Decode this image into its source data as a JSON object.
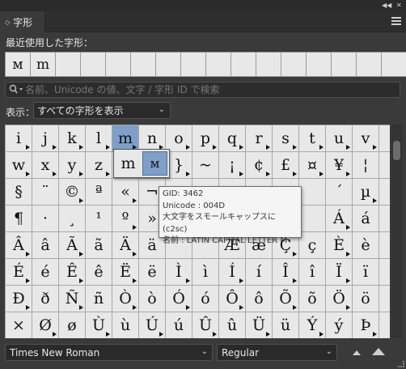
{
  "tab": {
    "title": "字形"
  },
  "recent": {
    "label": "最近使用した字形：",
    "glyphs": [
      "ᴍ",
      "m",
      "",
      "",
      "",
      "",
      "",
      "",
      "",
      "",
      "",
      "",
      "",
      "",
      "",
      ""
    ]
  },
  "search": {
    "placeholder": "名前、Unicode の値、文字 / 字形 ID で検索",
    "value": ""
  },
  "show": {
    "label": "表示：",
    "selected": "すべての字形を表示"
  },
  "glyph_grid": {
    "rows": [
      [
        "i",
        "j",
        "k",
        "l",
        "m",
        "n",
        "o",
        "p",
        "q",
        "r",
        "s",
        "t",
        "u",
        "v",
        ""
      ],
      [
        "w",
        "x",
        "y",
        "z",
        "",
        "",
        "}",
        "~",
        "¡",
        "¢",
        "£",
        "¤",
        "¥",
        "¦",
        ""
      ],
      [
        "§",
        "¨",
        "©",
        "ª",
        "«",
        "¬",
        "",
        "",
        "",
        "",
        "",
        "",
        "´",
        "µ",
        ""
      ],
      [
        "¶",
        "·",
        "¸",
        "¹",
        "º",
        "»",
        "",
        "",
        "",
        "",
        "",
        "",
        "Á",
        "á",
        ""
      ],
      [
        "Â",
        "â",
        "Ã",
        "ã",
        "Ä",
        "ä",
        "",
        "",
        "Æ",
        "æ",
        "Ç",
        "ç",
        "È",
        "è",
        ""
      ],
      [
        "É",
        "é",
        "Ê",
        "ê",
        "Ë",
        "ë",
        "Ì",
        "ì",
        "Í",
        "í",
        "Î",
        "î",
        "Ï",
        "ï",
        ""
      ],
      [
        "Ð",
        "ð",
        "Ñ",
        "ñ",
        "Ò",
        "ò",
        "Ó",
        "ó",
        "Ô",
        "ô",
        "Õ",
        "õ",
        "Ö",
        "ö",
        ""
      ],
      [
        "×",
        "Ø",
        "ø",
        "Ù",
        "ù",
        "Ú",
        "ú",
        "Û",
        "û",
        "Ü",
        "ü",
        "Ý",
        "ý",
        "Þ",
        ""
      ]
    ],
    "alternates_marked": [
      [
        0,
        0
      ],
      [
        0,
        1
      ],
      [
        0,
        2
      ],
      [
        0,
        3
      ],
      [
        0,
        4
      ],
      [
        0,
        5
      ],
      [
        0,
        6
      ],
      [
        0,
        7
      ],
      [
        0,
        8
      ],
      [
        0,
        9
      ],
      [
        0,
        10
      ],
      [
        0,
        11
      ],
      [
        0,
        12
      ],
      [
        0,
        13
      ],
      [
        1,
        0
      ],
      [
        1,
        1
      ],
      [
        1,
        2
      ],
      [
        1,
        3
      ],
      [
        1,
        6
      ],
      [
        1,
        8
      ],
      [
        1,
        9
      ],
      [
        1,
        10
      ],
      [
        1,
        11
      ],
      [
        1,
        12
      ],
      [
        2,
        2
      ],
      [
        2,
        4
      ],
      [
        2,
        13
      ],
      [
        3,
        4
      ],
      [
        3,
        12
      ],
      [
        4,
        0
      ],
      [
        4,
        2
      ],
      [
        4,
        4
      ],
      [
        4,
        10
      ],
      [
        4,
        12
      ],
      [
        5,
        0
      ],
      [
        5,
        2
      ],
      [
        5,
        4
      ],
      [
        5,
        6
      ],
      [
        5,
        8
      ],
      [
        5,
        10
      ],
      [
        5,
        12
      ],
      [
        6,
        0
      ],
      [
        6,
        2
      ],
      [
        6,
        4
      ],
      [
        6,
        6
      ],
      [
        6,
        8
      ],
      [
        6,
        10
      ],
      [
        6,
        12
      ],
      [
        7,
        1
      ],
      [
        7,
        3
      ],
      [
        7,
        5
      ],
      [
        7,
        7
      ],
      [
        7,
        9
      ],
      [
        7,
        11
      ],
      [
        7,
        13
      ]
    ],
    "selected": {
      "row": 0,
      "col": 4
    }
  },
  "alternates_popup": {
    "glyphs": [
      "m",
      "ᴍ"
    ],
    "highlighted_index": 1
  },
  "tooltip": {
    "gid": "GID: 3462",
    "unicode": "Unicode : 004D",
    "feature": "大文字をスモールキャップスに (c2sc)",
    "name": "名前 : LATIN CAPITAL LETTER M"
  },
  "font": {
    "family": "Times New Roman",
    "style": "Regular"
  },
  "colors": {
    "panel_bg": "#3a3a3a",
    "cell_bg": "#e8e8e8",
    "selection": "#7f9fc9"
  }
}
